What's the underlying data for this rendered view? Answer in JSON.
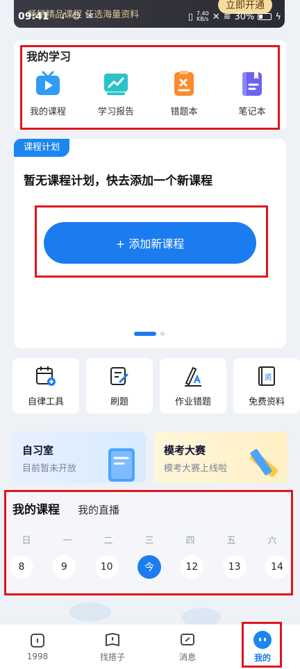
{
  "banner": {
    "promo": "畅销精品课程 任选海量资料",
    "open_label": "立即开通"
  },
  "status": {
    "time": "09:41",
    "speed": "7.40",
    "speed_unit": "KB/s",
    "battery": "30%"
  },
  "study": {
    "title": "我的学习",
    "items": [
      {
        "label": "我的课程",
        "icon": "tv-play-icon"
      },
      {
        "label": "学习报告",
        "icon": "chart-trend-icon"
      },
      {
        "label": "错题本",
        "icon": "mistake-book-icon"
      },
      {
        "label": "笔记本",
        "icon": "notebook-icon"
      }
    ]
  },
  "plan": {
    "tag": "课程计划",
    "empty_text": "暂无课程计划，快去添加一个新课程",
    "add_label": "+ 添加新课程"
  },
  "tools": [
    {
      "label": "自律工具",
      "icon": "calendar-add-icon"
    },
    {
      "label": "刷题",
      "icon": "edit-note-icon"
    },
    {
      "label": "作业错题",
      "icon": "pen-ruler-icon"
    },
    {
      "label": "免费资料",
      "icon": "document-icon",
      "badge": "资"
    }
  ],
  "promos": [
    {
      "title": "自习室",
      "sub": "目前暂未开放"
    },
    {
      "title": "模考大赛",
      "sub": "模考大赛上线啦"
    }
  ],
  "courses": {
    "tab_active": "我的课程",
    "tab_other": "我的直播",
    "weekdays": [
      "日",
      "一",
      "二",
      "三",
      "四",
      "五",
      "六"
    ],
    "dates": [
      "8",
      "9",
      "10",
      "今",
      "12",
      "13",
      "14"
    ]
  },
  "bottom_nav": [
    {
      "label": "1998",
      "icon": "home-icon"
    },
    {
      "label": "找搭子",
      "icon": "book-icon"
    },
    {
      "label": "消息",
      "icon": "message-icon"
    },
    {
      "label": "我的",
      "icon": "profile-icon",
      "active": true
    }
  ],
  "colors": {
    "accent": "#1b7cf0",
    "highlight": "#e0141e"
  }
}
